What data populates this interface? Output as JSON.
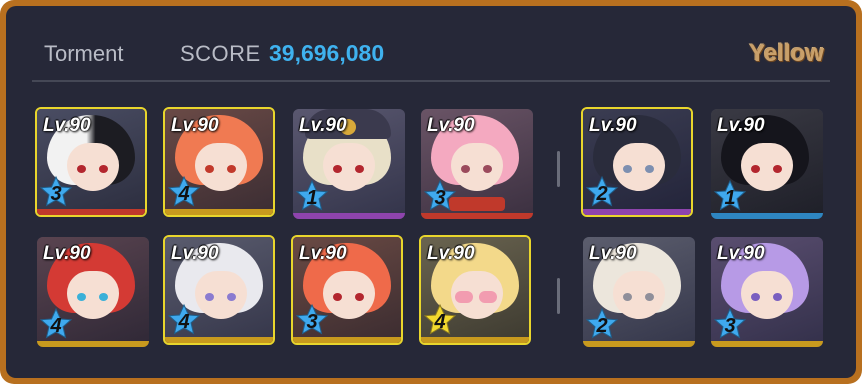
{
  "header": {
    "mode": "Torment",
    "score_label": "SCORE",
    "score_value": "39,696,080",
    "team_color_label": "Yellow"
  },
  "colors": {
    "frame": "#b8701f",
    "panel": "#262838",
    "score": "#3fb2ef",
    "highlight_border": "#e9d62c",
    "star_blue": "#3fa9ee",
    "star_yellow": "#f3d92e"
  },
  "striker_team_1": [
    {
      "level": "Lv.90",
      "star": "3",
      "bar": "#c0392b",
      "highlighted": true
    },
    {
      "level": "Lv.90",
      "star": "4",
      "bar": "#c89a1e",
      "highlighted": true
    },
    {
      "level": "Lv.90",
      "star": "1",
      "bar": "#8e44ad",
      "highlighted": false
    },
    {
      "level": "Lv.90",
      "star": "3",
      "bar": "#c0392b",
      "highlighted": false
    }
  ],
  "special_team_1": [
    {
      "level": "Lv.90",
      "star": "2",
      "bar": "#8e44ad",
      "highlighted": true
    },
    {
      "level": "Lv.90",
      "star": "1",
      "bar": "#2e86c1",
      "highlighted": false
    }
  ],
  "striker_team_2": [
    {
      "level": "Lv.90",
      "star": "4",
      "bar": "#c89a1e",
      "highlighted": false
    },
    {
      "level": "Lv.90",
      "star": "4",
      "bar": "#c89a1e",
      "highlighted": true
    },
    {
      "level": "Lv.90",
      "star": "3",
      "bar": "#c89a1e",
      "highlighted": true
    },
    {
      "level": "Lv.90",
      "star": "4",
      "bar": "#c89a1e",
      "highlighted": true
    }
  ],
  "special_team_2": [
    {
      "level": "Lv.90",
      "star": "2",
      "bar": "#c89a1e",
      "highlighted": false
    },
    {
      "level": "Lv.90",
      "star": "3",
      "bar": "#c89a1e",
      "highlighted": false
    }
  ]
}
